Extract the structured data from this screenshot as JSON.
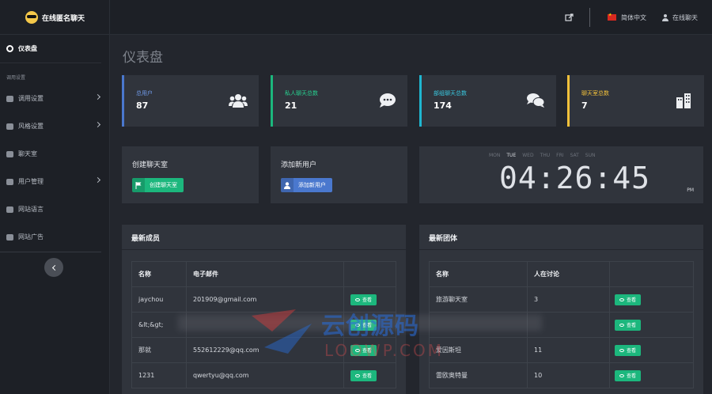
{
  "brand": {
    "name": "在线匿名聊天"
  },
  "topbar": {
    "language": "简体中文",
    "user": "在线聊天"
  },
  "sidebar": {
    "dashboard": "仪表盘",
    "section": "调用设置",
    "items": [
      {
        "label": "调用设置",
        "has_children": true
      },
      {
        "label": "风格设置",
        "has_children": true
      },
      {
        "label": "聊天室",
        "has_children": false
      },
      {
        "label": "用户管理",
        "has_children": true
      },
      {
        "label": "网站语言",
        "has_children": false
      },
      {
        "label": "网站广告",
        "has_children": false
      }
    ]
  },
  "page": {
    "title": "仪表盘"
  },
  "stats": [
    {
      "label": "总用户",
      "value": "87",
      "color": "#4a78ce",
      "icon": "users-icon"
    },
    {
      "label": "私人聊天总数",
      "value": "21",
      "color": "#1cb77d",
      "icon": "comment-icon"
    },
    {
      "label": "部组聊天总数",
      "value": "174",
      "color": "#1fb6d0",
      "icon": "comments-icon"
    },
    {
      "label": "聊天室总数",
      "value": "7",
      "color": "#f3c13b",
      "icon": "building-icon"
    }
  ],
  "cards": {
    "create_room": {
      "title": "创建聊天室",
      "button": "创建聊天室",
      "color": "#1cb77d"
    },
    "add_user": {
      "title": "添加新用户",
      "button": "添加新用户",
      "color": "#4a78ce"
    }
  },
  "clock": {
    "days": [
      "MON",
      "TUE",
      "WED",
      "THU",
      "FRI",
      "SAT",
      "SUN"
    ],
    "active_day": "TUE",
    "time": "04:26:45",
    "ampm": "PM"
  },
  "members": {
    "title": "最新成员",
    "headers": [
      "名称",
      "电子邮件",
      ""
    ],
    "rows": [
      {
        "name": "jaychou",
        "email": "201909@gmail.com",
        "action": "查看"
      },
      {
        "name": "&lt;&gt;",
        "email": "",
        "action": "查看"
      },
      {
        "name": "那就",
        "email": "552612229@qq.com",
        "action": "查看"
      },
      {
        "name": "1231",
        "email": "qwertyu@qq.com",
        "action": "查看"
      }
    ]
  },
  "groups": {
    "title": "最新团体",
    "headers": [
      "名称",
      "人在讨论",
      ""
    ],
    "rows": [
      {
        "name": "旅游聊天室",
        "count": "3",
        "action": "查看"
      },
      {
        "name": "",
        "count": "",
        "action": "查看"
      },
      {
        "name": "爱因斯坦",
        "count": "11",
        "action": "查看"
      },
      {
        "name": "雷欧奥特曼",
        "count": "10",
        "action": "查看"
      }
    ]
  },
  "watermark": {
    "text": "云创源码",
    "sub": "LOOWP.COM"
  }
}
